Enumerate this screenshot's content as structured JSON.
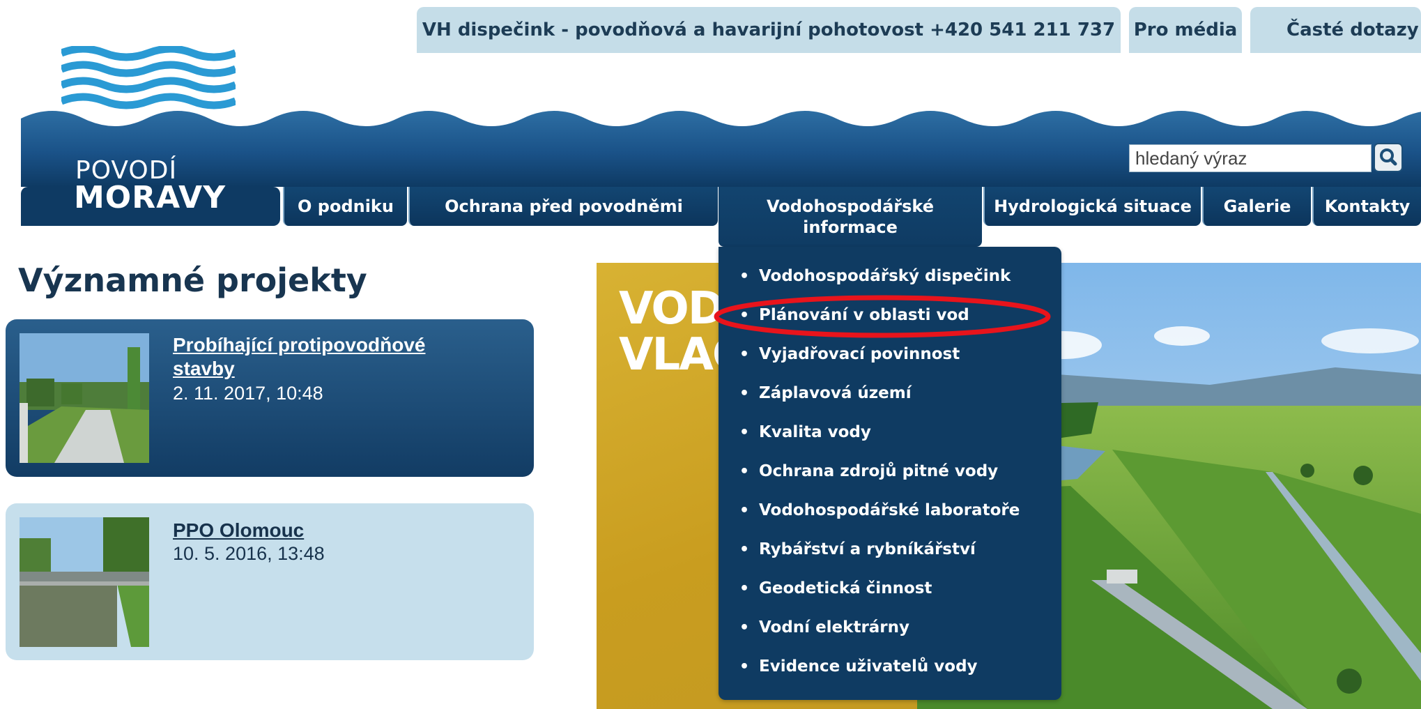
{
  "utility_bar": {
    "dispatch": "VH dispečink - povodňová a havarijní pohotovost +420 541 211 737",
    "media": "Pro média",
    "faq": "Časté dotazy"
  },
  "logo": {
    "line1": "POVODÍ",
    "line2": "MORAVY"
  },
  "search": {
    "placeholder": "hledaný výraz"
  },
  "nav": {
    "o_podniku": "O podniku",
    "ochrana": "Ochrana před povodněmi",
    "vodohosp_line1": "Vodohospodářské",
    "vodohosp_line2": "informace",
    "hydrologicka": "Hydrologická situace",
    "galerie": "Galerie",
    "kontakty": "Kontakty"
  },
  "dropdown": {
    "items": [
      "Vodohospodářský dispečink",
      "Plánování v oblasti vod",
      "Vyjadřovací povinnost",
      "Záplavová území",
      "Kvalita vody",
      "Ochrana zdrojů pitné vody",
      "Vodohospodářské laboratoře",
      "Rybářství a rybníkářství",
      "Geodetická činnost",
      "Vodní elektrárny",
      "Evidence uživatelů vody"
    ],
    "bullet": "•",
    "highlighted_item": "Plánování v oblasti vod"
  },
  "section": {
    "title": "Významné projekty"
  },
  "projects": [
    {
      "title_line1": "Probíhající protipovodňové",
      "title_line2": "stavby",
      "date": "2. 11. 2017, 10:48"
    },
    {
      "title_line1": "PPO Olomouc",
      "date": "10. 5. 2016, 13:48"
    }
  ],
  "hero": {
    "line1": "VODN",
    "line2": "VLACH"
  },
  "colors": {
    "brand_blue": "#0f3b62",
    "light_blue": "#c5dde8",
    "highlight_red": "#e8141c",
    "hero_yellow": "#d0a52a"
  }
}
